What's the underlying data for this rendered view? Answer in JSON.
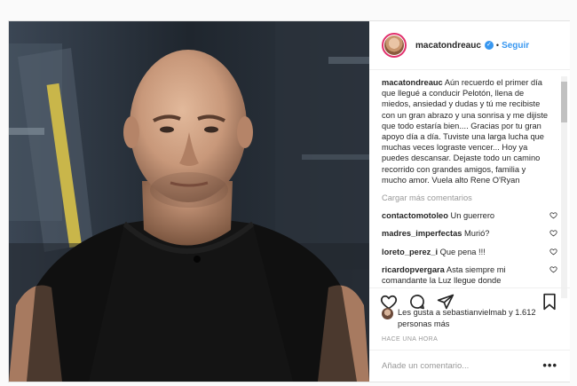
{
  "post": {
    "username": "macatondreauc",
    "follow_label": "Seguir",
    "separator": "•",
    "caption_user": "macatondreauc",
    "caption_text": "Aún recuerdo el primer día que llegué a conducir Pelotón, llena de miedos, ansiedad y dudas y tú me recibiste con un gran abrazo y una sonrisa y me dijiste que todo estaría bien.... Gracias por tu gran apoyo día a día. Tuviste una larga lucha que muchas veces lograste vencer... Hoy ya puedes descansar. Dejaste todo un camino recorrido con grandes amigos, familia y mucho amor. Vuela alto Rene O'Ryan",
    "load_more": "Cargar más comentarios",
    "comments": [
      {
        "user": "contactomotoleo",
        "text": "Un guerrero"
      },
      {
        "user": "madres_imperfectas",
        "text": "Murió?"
      },
      {
        "user": "loreto_perez_i",
        "text": "Que pena !!!"
      },
      {
        "user": "ricardopvergara",
        "text": "Asta siempre mi comandante la Luz llegue donde"
      }
    ],
    "likes_text": "Les gusta a sebastianvielmab y 1.612 personas más",
    "time": "HACE UNA HORA",
    "add_comment_placeholder": "Añade un comentario...",
    "more_label": "•••"
  },
  "icons": {
    "verified": "verified-badge-icon",
    "heart": "heart-icon",
    "comment": "comment-icon",
    "share": "share-icon",
    "save": "bookmark-icon"
  },
  "colors": {
    "link": "#3897f0",
    "text": "#262626",
    "muted": "#999999",
    "border": "#efefef"
  }
}
